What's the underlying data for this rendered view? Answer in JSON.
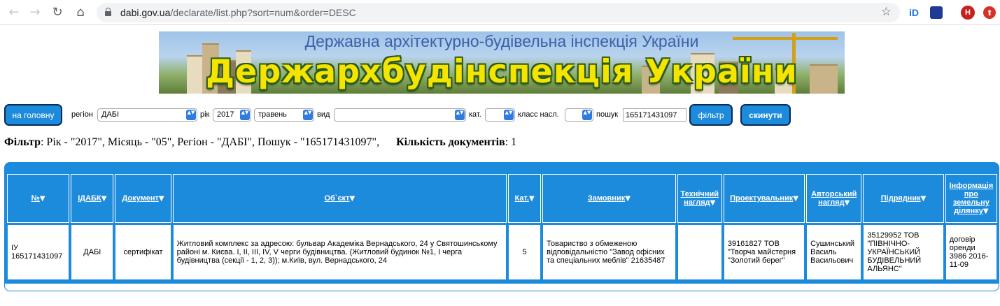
{
  "browser": {
    "back_icon": "←",
    "forward_icon": "→",
    "reload_icon": "↻",
    "home_icon": "⌂",
    "url_host": "dabi.gov.ua",
    "url_path": "/declarate/list.php?sort=num&order=DESC",
    "star_icon": "☆",
    "ext_id_label": "iD",
    "avatar_initial": "Н",
    "update_icon": "⬆"
  },
  "banner": {
    "subtitle": "Державна архітектурно-будівельна інспекція України",
    "title": "Держархбудінспекція України"
  },
  "filters": {
    "home_button": "на головну",
    "region_label": "регіон",
    "region_value": "ДАБІ",
    "year_label": "рік",
    "year_value": "2017",
    "month_value": "травень",
    "type_label": "вид",
    "type_value": "",
    "category_label": "кат.",
    "category_value": "",
    "class_label": "класс насл.",
    "class_value": "",
    "search_label": "пошук",
    "search_value": "165171431097",
    "filter_button": "фільтр",
    "reset_button": "скинути",
    "arrow_icon": "▲▼"
  },
  "summary": {
    "filter_label": "Фільтр",
    "filter_text": ": Рік - \"2017\", Місяць - \"05\", Регіон - \"ДАБІ\", Пошук - \"165171431097\",",
    "count_label": "Кількість документів",
    "count_value": ": 1"
  },
  "table": {
    "sort_icon": "▼",
    "columns": [
      {
        "label": "№"
      },
      {
        "label": "ІДАБК"
      },
      {
        "label": "Документ"
      },
      {
        "label": "Об`єкт"
      },
      {
        "label": "Кат."
      },
      {
        "label": "Замовник"
      },
      {
        "label": "Технічний нагляд"
      },
      {
        "label": "Проектувальник"
      },
      {
        "label": "Авторський нагляд"
      },
      {
        "label": "Підрядник"
      },
      {
        "label": "Інформація про земельну ділянку"
      }
    ],
    "rows": [
      {
        "number": "ІУ 165171431097",
        "idabk": "ДАБІ",
        "document": "сертифікат",
        "object": "Житловий комплекс за адресою: бульвар Академіка Вернадського, 24 у Святошинському районі м. Києва. I, II, III, IV, V черги будівництва. (Житловий будинок №1, І черга будівництва (секції - 1, 2, 3)); м.Київ, вул. Вернадського, 24",
        "category": "5",
        "customer": "Товариство з обмеженою відповідальністю \"Завод офісних та спеціальних меблів\" 21635487",
        "tech_supervision": "",
        "designer": "39161827 ТОВ \"Творча майстерня \"Золотий берег\"",
        "author_supervision": "Сушинський Василь Васильович",
        "contractor": "35129952 ТОВ \"ПІВНІЧНО-УКРАЇНСЬКИЙ БУДІВЕЛЬНИЙ АЛЬЯНС\"",
        "land_info": "договір оренди 3986 2016-11-09"
      }
    ]
  }
}
